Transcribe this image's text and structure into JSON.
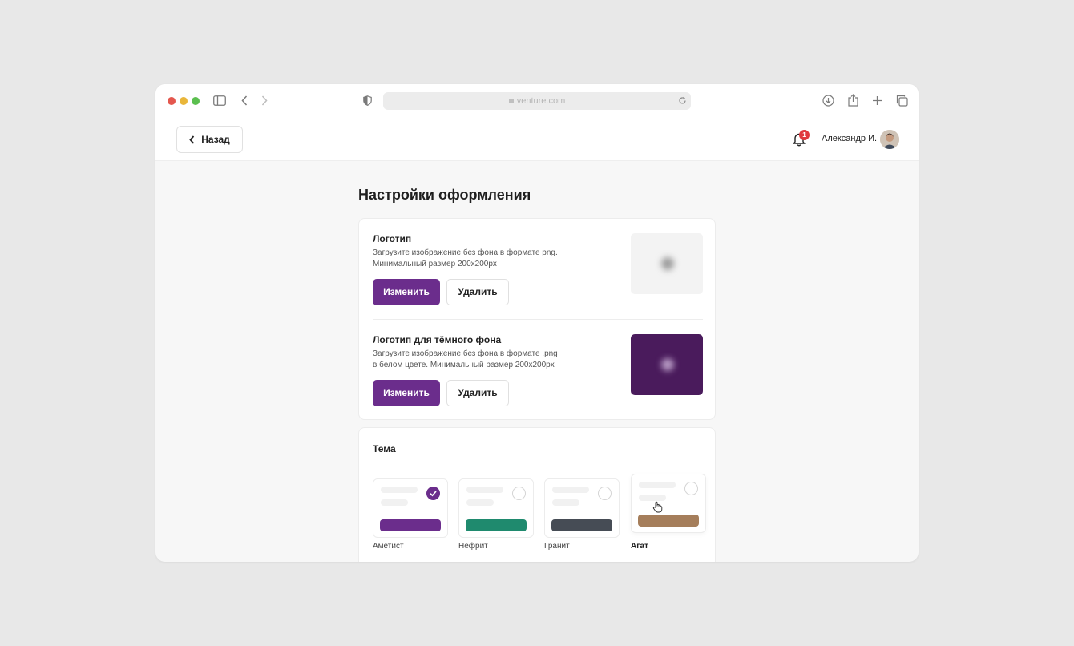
{
  "browser": {
    "url": "venture.com",
    "traffic_lights": [
      "#e4574e",
      "#e9b63a",
      "#5bbf4f"
    ]
  },
  "header": {
    "back_label": "Назад",
    "notifications_count": "1",
    "user_name": "Александр И."
  },
  "page": {
    "title": "Настройки оформления"
  },
  "logo_section": {
    "title": "Логотип",
    "desc_line1": "Загрузите изображение без фона в формате png.",
    "desc_line2": "Минимальный размер 200x200px",
    "change_label": "Изменить",
    "delete_label": "Удалить"
  },
  "dark_logo_section": {
    "title": "Логотип для тёмного фона",
    "desc_line1": "Загрузите изображение без фона в формате .png",
    "desc_line2": "в белом цвете. Минимальный размер 200x200px",
    "change_label": "Изменить",
    "delete_label": "Удалить"
  },
  "theme": {
    "title": "Тема",
    "options": [
      {
        "label": "Аметист",
        "color": "#6b2d8c",
        "selected": true
      },
      {
        "label": "Нефрит",
        "color": "#1f8a6e",
        "selected": false
      },
      {
        "label": "Гранит",
        "color": "#464c55",
        "selected": false
      },
      {
        "label": "Агат",
        "color": "#a57e5b",
        "selected": false
      }
    ]
  },
  "colors": {
    "accent": "#6b2d8c",
    "badge": "#e0393e"
  }
}
